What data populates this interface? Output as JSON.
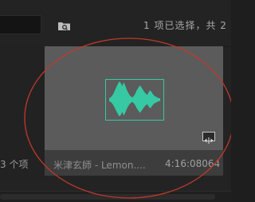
{
  "toolbar": {
    "search_value": "",
    "folder_icon": "folder-search-icon",
    "selection_status": "1 项已选择，共 2"
  },
  "side_panel": {
    "item_count": "3 个项"
  },
  "clip": {
    "name": "米津玄師 - Lemon....",
    "duration": "4:16:08064",
    "thumbnail_icon": "audio-waveform-icon",
    "badge_icon": "merged-clip-icon"
  },
  "colors": {
    "waveform": "#36c9a3",
    "annotation": "#c0392b",
    "thumbnail_bg": "#5b5b5b"
  }
}
